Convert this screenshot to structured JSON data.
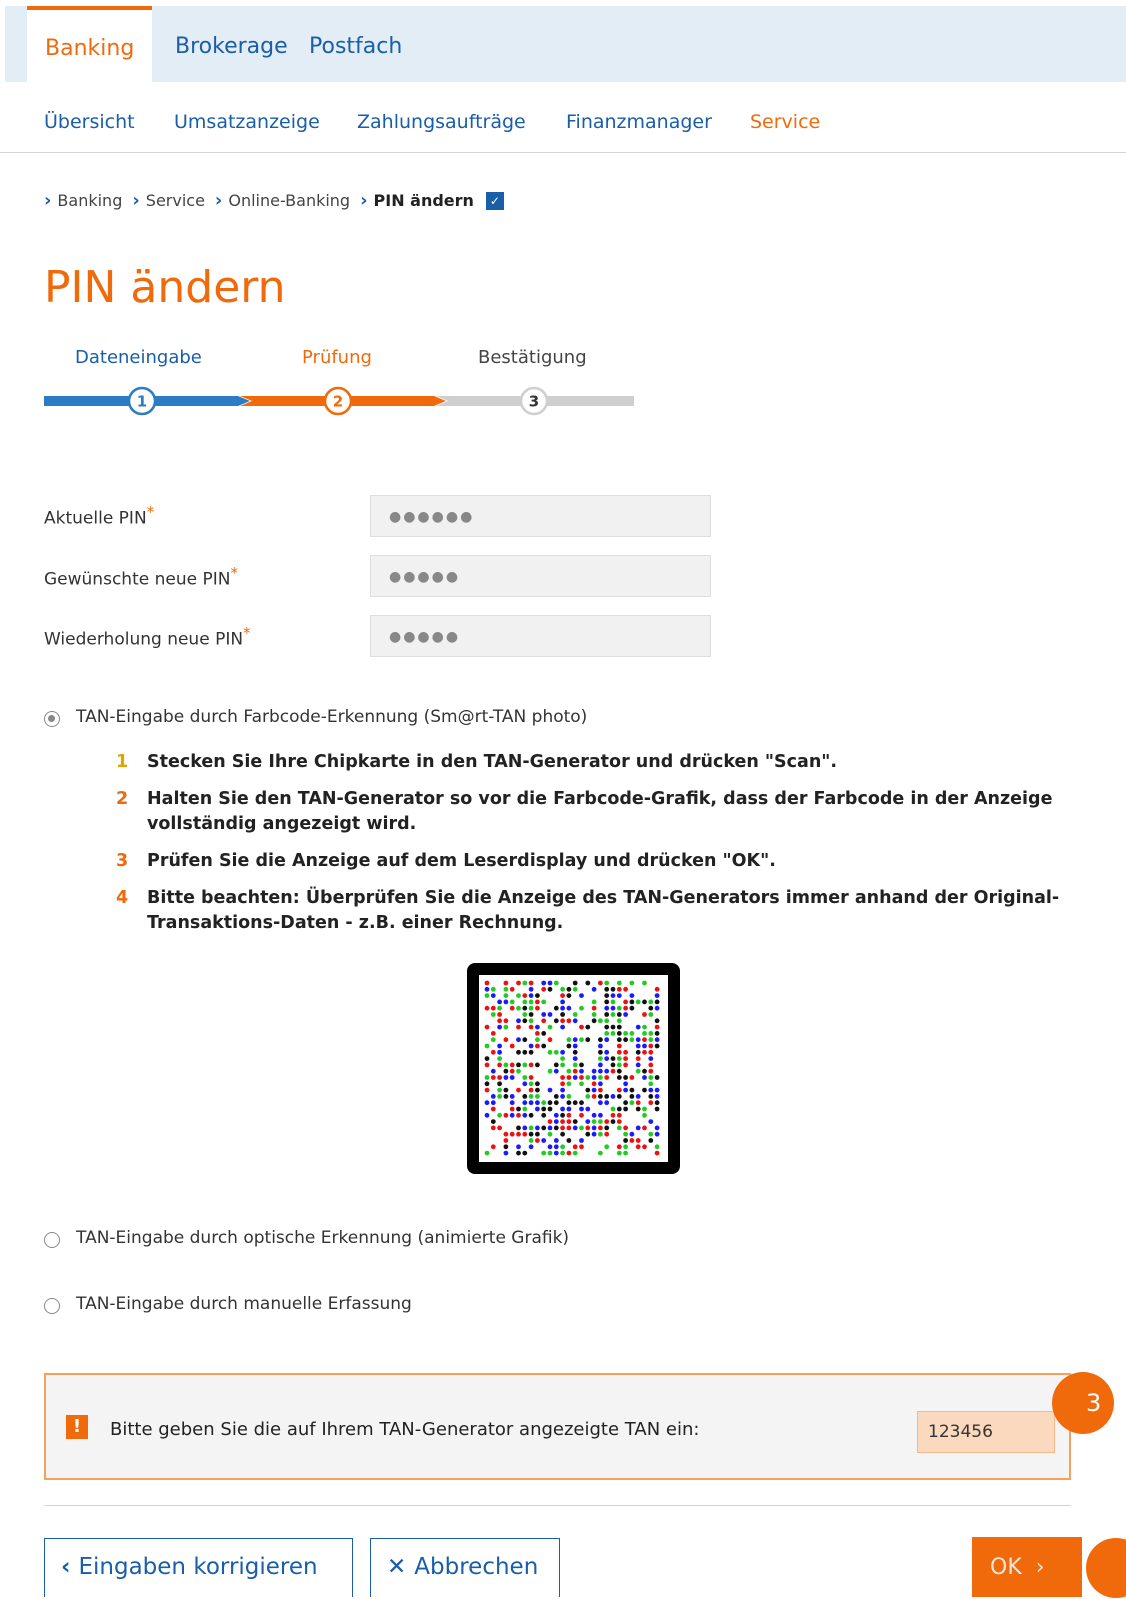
{
  "main_nav": {
    "items": [
      "Banking",
      "Brokerage",
      "Postfach"
    ],
    "active": "Banking"
  },
  "sub_nav": {
    "items": [
      "Übersicht",
      "Umsatzanzeige",
      "Zahlungsaufträge",
      "Finanzmanager",
      "Service"
    ],
    "active": "Service"
  },
  "breadcrumb": [
    "Banking",
    "Service",
    "Online-Banking",
    "PIN ändern"
  ],
  "page_title": "PIN ändern",
  "stepper": {
    "steps": [
      {
        "label": "Dateneingabe",
        "number": "1",
        "state": "done",
        "color": "#2b7cc2"
      },
      {
        "label": "Prüfung",
        "number": "2",
        "state": "active",
        "color": "#f06a0c"
      },
      {
        "label": "Bestätigung",
        "number": "3",
        "state": "pending",
        "color": "#cfcfcf"
      }
    ]
  },
  "form": {
    "fields": [
      {
        "label": "Aktuelle PIN",
        "required_mark": "*",
        "value": "●●●●●●"
      },
      {
        "label": "Gewünschte neue PIN",
        "required_mark": "*",
        "value": "●●●●●"
      },
      {
        "label": "Wiederholung neue PIN",
        "required_mark": "*",
        "value": "●●●●●"
      }
    ]
  },
  "tan_options": [
    {
      "label": "TAN-Eingabe durch Farbcode-Erkennung (Sm@rt-TAN photo)",
      "checked": true
    },
    {
      "label": "TAN-Eingabe durch optische Erkennung (animierte Grafik)",
      "checked": false
    },
    {
      "label": "TAN-Eingabe durch manuelle Erfassung",
      "checked": false
    }
  ],
  "instructions": [
    {
      "n": "1",
      "text": "Stecken Sie Ihre Chipkarte in den TAN-Generator und drücken \"Scan\"."
    },
    {
      "n": "2",
      "text": "Halten Sie den TAN-Generator so vor die Farbcode-Grafik, dass der Farbcode in der Anzeige vollständig angezeigt wird."
    },
    {
      "n": "3",
      "text": "Prüfen Sie die Anzeige auf dem Leserdisplay und drücken \"OK\"."
    },
    {
      "n": "4",
      "text": "Bitte beachten: Überprüfen Sie die Anzeige des TAN-Generators immer anhand der Original-Transaktions-Daten - z.B. einer Rechnung."
    }
  ],
  "tan_prompt": {
    "warning_icon": "!",
    "text": "Bitte geben Sie die auf Ihrem TAN-Generator angezeigte TAN ein:",
    "value": "123456",
    "badge": "3"
  },
  "buttons": {
    "back": "Eingaben korrigieren",
    "cancel": "Abbrechen",
    "ok": "OK"
  },
  "colors": {
    "accent": "#f06a0c",
    "link": "#1a5ea8"
  }
}
